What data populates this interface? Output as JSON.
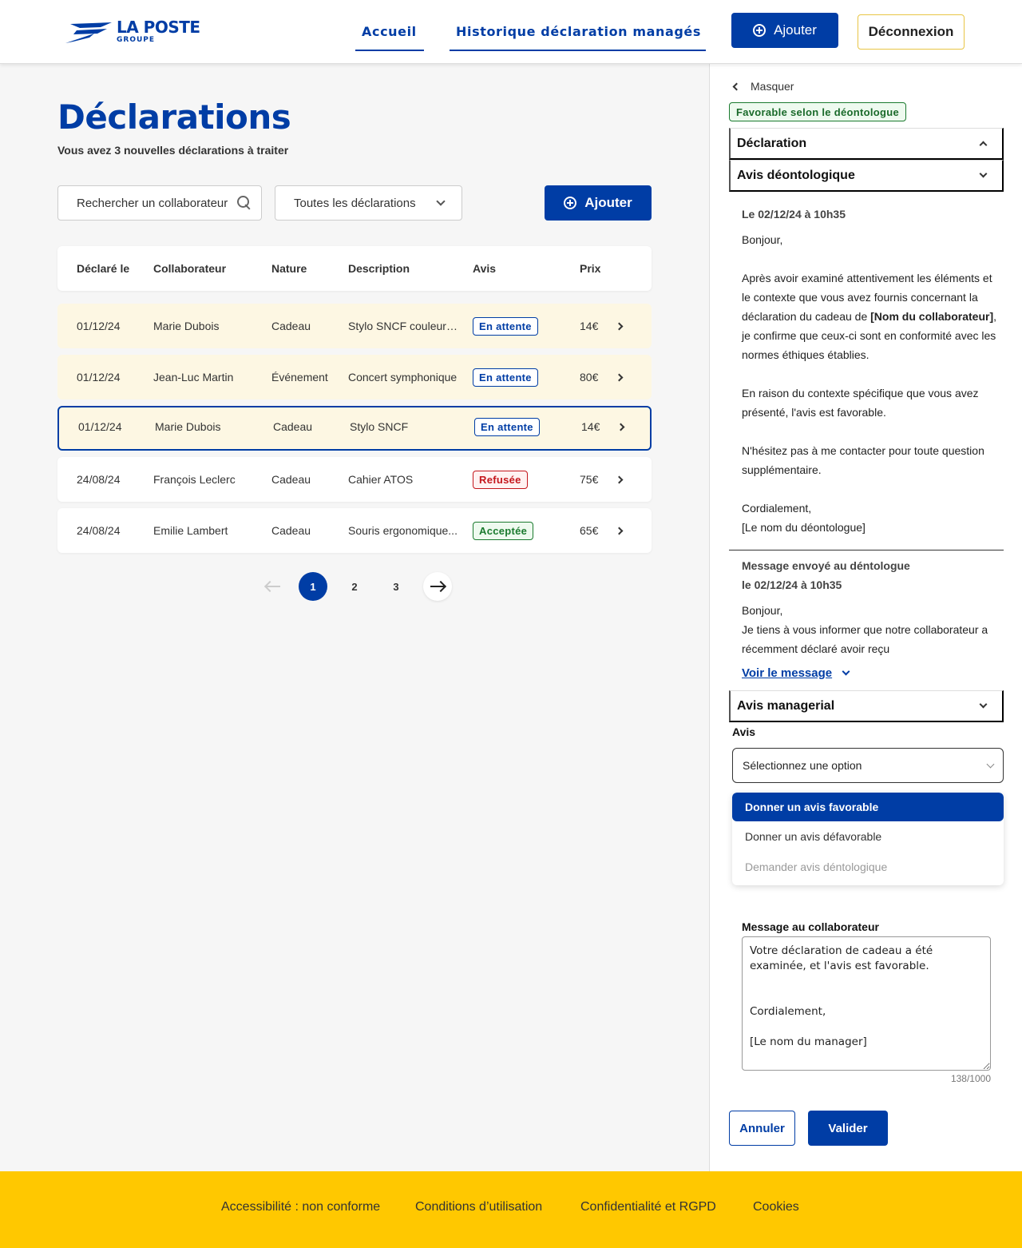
{
  "header": {
    "logo_main": "LA POSTE",
    "logo_sub": "GROUPE",
    "nav": [
      "Accueil",
      "Historique déclaration managés"
    ],
    "add_label": "Ajouter",
    "logout_label": "Déconnexion"
  },
  "main": {
    "title": "Déclarations",
    "subtitle": "Vous avez 3 nouvelles déclarations à traiter",
    "search_placeholder": "Rechercher un collaborateur",
    "filter_value": "Toutes les déclarations",
    "add_label": "Ajouter",
    "columns": [
      "Déclaré le",
      "Collaborateur",
      "Nature",
      "Description",
      "Avis",
      "Prix"
    ],
    "rows": [
      {
        "date": "01/12/24",
        "collaborator": "Marie Dubois",
        "nature": "Cadeau",
        "description": "Stylo SNCF couleur r...",
        "avis": "En attente",
        "prix": "14€"
      },
      {
        "date": "01/12/24",
        "collaborator": "Jean-Luc Martin",
        "nature": "Événement",
        "description": "Concert symphonique",
        "avis": "En attente",
        "prix": "80€"
      },
      {
        "date": "01/12/24",
        "collaborator": "Marie Dubois",
        "nature": "Cadeau",
        "description": "Stylo SNCF",
        "avis": "En attente",
        "prix": "14€"
      },
      {
        "date": "24/08/24",
        "collaborator": "François Leclerc",
        "nature": "Cadeau",
        "description": "Cahier ATOS",
        "avis": "Refusée",
        "prix": "75€"
      },
      {
        "date": "24/08/24",
        "collaborator": "Emilie Lambert",
        "nature": "Cadeau",
        "description": "Souris ergonomique...",
        "avis": "Acceptée",
        "prix": "65€"
      }
    ],
    "pagination": {
      "pages": [
        "1",
        "2",
        "3"
      ],
      "current": "1"
    }
  },
  "panel": {
    "hide_label": "Masquer",
    "status_badge": "Favorable selon le déontologue",
    "section_declaration": "Déclaration",
    "section_avis_deonto": "Avis déontologique",
    "deonto_date": "Le 02/12/24 à 10h35",
    "deonto_greeting": "Bonjour,",
    "deonto_p1_before": "Après avoir examiné attentivement les éléments et le contexte que vous avez fournis concernant la déclaration du cadeau de ",
    "deonto_p1_bold": "[Nom du collaborateur]",
    "deonto_p1_after": ", je confirme que ceux-ci sont en conformité avec les normes éthiques établies.",
    "deonto_p2": "En raison du contexte spécifique que vous avez présenté, l'avis est favorable.",
    "deonto_p3": "N'hésitez pas à me contacter pour toute question supplémentaire.",
    "deonto_closing": "Cordialement,",
    "deonto_signature": " [Le nom du déontologue]",
    "sent_title": "Message envoyé au déntologue",
    "sent_date": "le 02/12/24 à 10h35",
    "sent_greeting": "Bonjour,",
    "sent_excerpt": "Je tiens à vous informer que notre collaborateur a récemment déclaré avoir reçu",
    "see_message": "Voir le message",
    "section_avis_manager": "Avis managerial",
    "avis_label": "Avis",
    "avis_placeholder": "Sélectionnez une option",
    "avis_options": [
      "Donner un avis favorable",
      "Donner un avis défavorable",
      "Demander avis déntologique"
    ],
    "message_label": "Message au collaborateur",
    "message_value": "Votre déclaration de cadeau a été examinée, et l'avis est favorable.\n\n\nCordialement,\n\n[Le nom du manager]",
    "counter": "138/1000",
    "cancel_label": "Annuler",
    "validate_label": "Valider"
  },
  "footer": {
    "links": [
      "Accessibilité : non conforme",
      "Conditions d’utilisation",
      "Confidentialité et RGPD",
      "Cookies"
    ]
  },
  "colors": {
    "brand_blue": "#003da5",
    "footer_yellow": "#ffc800",
    "pending_row": "#fdf7e3",
    "refused": "#c4161c",
    "accepted": "#1a7a2e"
  }
}
